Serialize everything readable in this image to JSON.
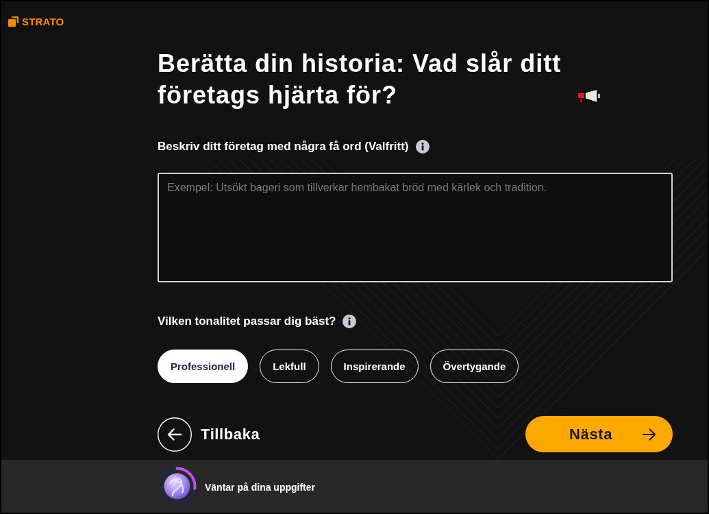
{
  "brand": {
    "name": "STRATO"
  },
  "title": "Berätta din historia: Vad slår ditt företags hjärta för?",
  "description": {
    "label": "Beskriv ditt företag med några få ord (Valfritt)",
    "placeholder": "Exempel: Utsökt bageri som tillverkar hembakat bröd med kärlek och tradition."
  },
  "tone": {
    "label": "Vilken tonalitet passar dig bäst?",
    "options": [
      {
        "label": "Professionell",
        "selected": true
      },
      {
        "label": "Lekfull",
        "selected": false
      },
      {
        "label": "Inspirerande",
        "selected": false
      },
      {
        "label": "Övertygande",
        "selected": false
      }
    ]
  },
  "navigation": {
    "back": "Tillbaka",
    "next": "Nästa"
  },
  "status_bar": {
    "message": "Väntar på dina uppgifter"
  }
}
